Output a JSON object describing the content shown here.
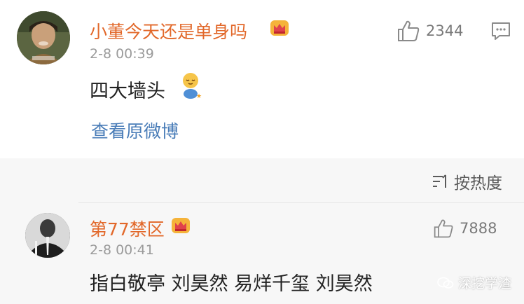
{
  "comments": [
    {
      "username": "小董今天还是单身吗",
      "timestamp": "2-8 00:39",
      "likes": "2344",
      "text": "四大墙头",
      "view_original": "查看原微博"
    },
    {
      "username": "第77禁区",
      "timestamp": "2-8 00:41",
      "likes": "7888",
      "text": "指白敬亭 刘昊然 易烊千玺 刘昊然"
    }
  ],
  "sort": {
    "label": "按热度"
  },
  "watermark": {
    "text": "深挖学渣"
  },
  "icons": {
    "like": "thumbs-up-icon",
    "reply": "comment-icon",
    "sort": "sort-icon",
    "badge": "crown-badge-icon",
    "emoji": "sleepy-emoji-icon",
    "watermark": "wechat-icon"
  },
  "colors": {
    "username": "#e2682a",
    "link": "#4a7db8",
    "timestamp": "#9b9b9b",
    "text": "#222222",
    "background": "#f7f7f7",
    "card": "#ffffff"
  }
}
